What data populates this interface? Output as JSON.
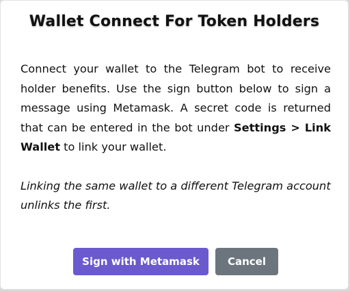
{
  "dialog": {
    "title": "Wallet Connect For Token Holders",
    "paragraph1": {
      "text_before": "Connect your wallet to the Telegram bot to receive holder benefits. Use the sign button below to sign a message using Metamask. A secret code is returned that can be entered in the bot under ",
      "bold_text": "Settings > Link Wallet",
      "text_after": " to link your wallet."
    },
    "paragraph2": "Linking the same wallet to a different Telegram account unlinks the first.",
    "buttons": {
      "sign_label": "Sign with Metamask",
      "cancel_label": "Cancel"
    },
    "colors": {
      "primary": "#6a5acd",
      "secondary": "#6c757d"
    }
  }
}
